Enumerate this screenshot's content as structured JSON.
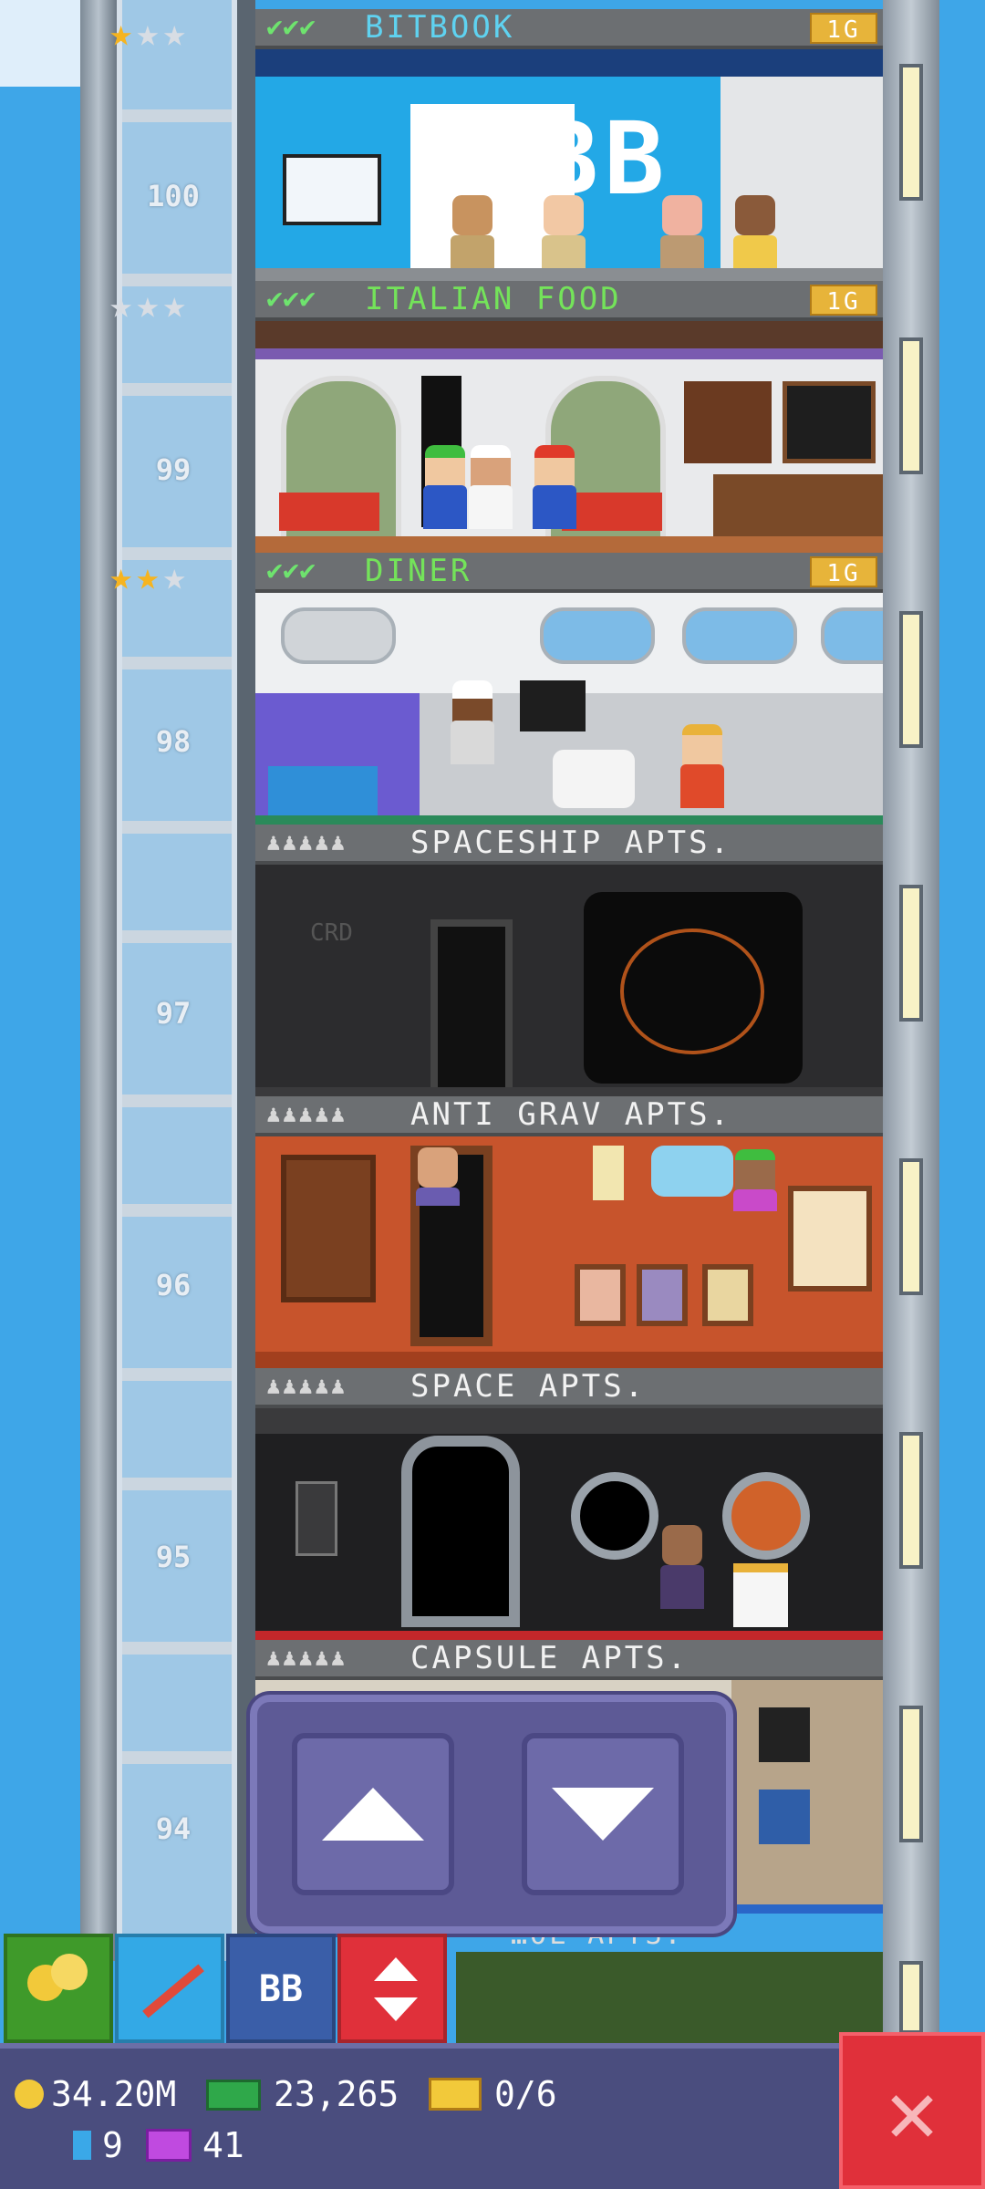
{
  "floors": [
    {
      "number": "100",
      "name": "BITBOOK",
      "type": "service",
      "level": "1G",
      "checks": "✔✔✔",
      "stars": {
        "gold": "★",
        "silver": "★★"
      }
    },
    {
      "number": "99",
      "name": "ITALIAN FOOD",
      "type": "food",
      "level": "1G",
      "checks": "✔✔✔",
      "stars": {
        "gold": "",
        "silver": "★★★"
      }
    },
    {
      "number": "98",
      "name": "DINER",
      "type": "food",
      "level": "1G",
      "checks": "✔✔✔",
      "stars": {
        "gold": "★★",
        "silver": "★"
      }
    },
    {
      "number": "97",
      "name": "SPACESHIP APTS.",
      "type": "residential",
      "people": "♟♟♟♟♟"
    },
    {
      "number": "96",
      "name": "ANTI GRAV APTS.",
      "type": "residential",
      "people": "♟♟♟♟♟"
    },
    {
      "number": "95",
      "name": "SPACE APTS.",
      "type": "residential",
      "people": "♟♟♟♟♟"
    },
    {
      "number": "94",
      "name": "CAPSULE APTS.",
      "type": "residential",
      "people": "♟♟♟♟♟"
    }
  ],
  "room_text": {
    "bitbook_logo": "BB",
    "spaceship_sign": "CRD"
  },
  "hidden_floor_label": "…OL APTS.",
  "toolbar": {
    "coins_icon": "coins-icon",
    "pickaxe_icon": "pickaxe-icon",
    "bitbook_label": "BB",
    "elevator_icon": "elevator-arrows-icon"
  },
  "stats": {
    "coins": "34.20M",
    "bux": "23,265",
    "tickets": "0/6",
    "bitizens": "9",
    "vip": "41"
  },
  "colors": {
    "sky": "#3ea6e8",
    "status_bar": "#4a4d7e",
    "close_button": "#e0303a",
    "gold_star": "#f6b420",
    "check_green": "#6ee36e"
  }
}
